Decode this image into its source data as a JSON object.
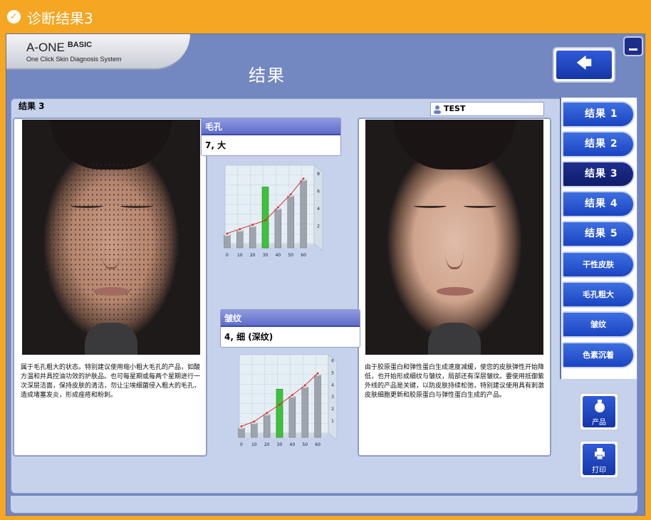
{
  "window": {
    "title": "诊断结果3"
  },
  "logo": {
    "brand": "A-ONE",
    "edition": "BASIC",
    "tagline": "One Click Skin Diagnosis System"
  },
  "header": {
    "page_title": "结果"
  },
  "panel": {
    "result_label": "结果 3",
    "user_name": "TEST"
  },
  "left": {
    "metric_title": "毛孔",
    "metric_value": "7, 大",
    "description": "属于毛孔粗大的状态。特别建议使用缩小粗大毛孔的产品，如酸方温和并具控油功效的护肤品。也可每星期或每两个星期进行一次深层洁面，保持皮肤的清洁，勿让尘埃细菌侵入粗大的毛孔，造成堵塞发炎，形成痤疮和粉刺。"
  },
  "middle": {
    "metric_title": "皱纹",
    "metric_value": "4, 细 (深纹)"
  },
  "right": {
    "description": "由于胶原蛋白和弹性蛋白生成速度减缓，使您的皮肤弹性开始降低，也开始形成细纹与皱纹，局部还有深层皱纹。要使用抵御紫外线的产品是关键，以防皮肤持续松弛，特别建议使用具有刺激皮肤细胞更新和胶原蛋白与弹性蛋白生成的产品。"
  },
  "sidebar": {
    "items": [
      {
        "label": "结果 1",
        "active": false
      },
      {
        "label": "结果 2",
        "active": false
      },
      {
        "label": "结果 3",
        "active": true
      },
      {
        "label": "结果 4",
        "active": false
      },
      {
        "label": "结果 5",
        "active": false
      },
      {
        "label": "干性皮肤",
        "active": false
      },
      {
        "label": "毛孔粗大",
        "active": false
      },
      {
        "label": "皱纹",
        "active": false
      },
      {
        "label": "色素沉着",
        "active": false
      }
    ]
  },
  "tools": {
    "product_label": "产品",
    "print_label": "打印"
  },
  "icons": {
    "back": "back-arrow-icon",
    "minimize": "minimize-icon",
    "user": "user-icon",
    "product": "product-bottle-icon",
    "print": "printer-icon",
    "check": "check-circle-icon"
  },
  "colors": {
    "frame": "#f5a623",
    "app_bg": "#7388c0",
    "accent": "#1a44c2",
    "highlight_bar": "#3ec23e"
  },
  "chart_data": [
    {
      "type": "bar",
      "categories": [
        "0",
        "10",
        "20",
        "30",
        "40",
        "50",
        "60"
      ],
      "values": [
        1.5,
        2.0,
        2.5,
        3.0,
        4.5,
        6.0,
        7.8
      ],
      "highlight_index": 3,
      "highlight_value": 7.0,
      "trend_line": true,
      "yticks": [
        "2",
        "4",
        "6",
        "8"
      ],
      "ylim": [
        0,
        9
      ]
    },
    {
      "type": "bar",
      "categories": [
        "0",
        "10",
        "20",
        "30",
        "40",
        "50",
        "60"
      ],
      "values": [
        0.8,
        1.2,
        1.9,
        2.6,
        3.4,
        4.2,
        5.2
      ],
      "highlight_index": 3,
      "highlight_value": 4.0,
      "trend_line": true,
      "yticks": [
        "1",
        "2",
        "3",
        "4",
        "5",
        "6"
      ],
      "ylim": [
        0,
        6.5
      ]
    }
  ]
}
